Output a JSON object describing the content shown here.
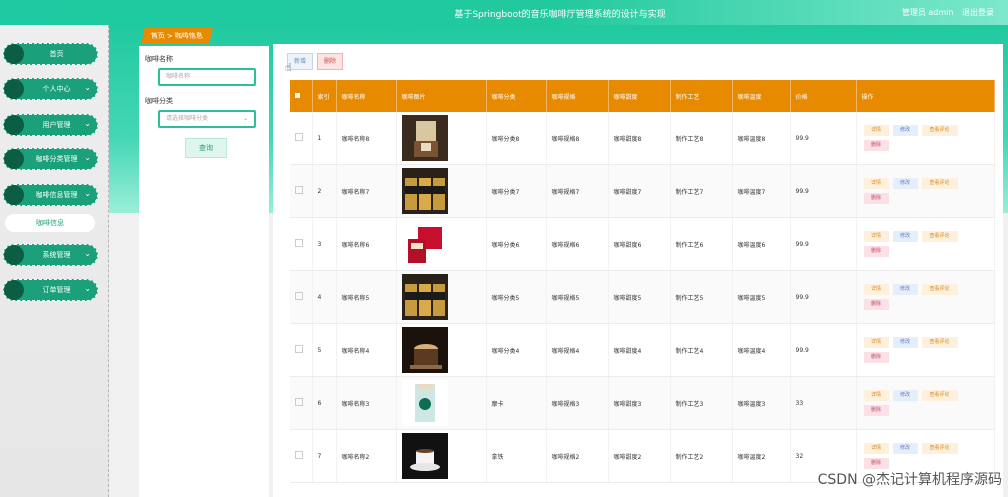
{
  "header": {
    "title": "基于Springboot的音乐咖啡厅管理系统的设计与实现",
    "user": "管理员 admin",
    "logout": "退出登录"
  },
  "sidebar": {
    "items": [
      {
        "label": "首页",
        "expandable": false
      },
      {
        "label": "个人中心",
        "expandable": true
      },
      {
        "label": "用户管理",
        "expandable": true
      },
      {
        "label": "咖啡分类管理",
        "expandable": true
      },
      {
        "label": "咖啡信息管理",
        "expandable": true
      },
      {
        "label": "系统管理",
        "expandable": true
      },
      {
        "label": "订单管理",
        "expandable": true
      }
    ],
    "sub_item": "咖啡信息"
  },
  "tabs": {
    "home": "首页",
    "sep": ">",
    "current": "咖啡信息"
  },
  "search": {
    "name_label": "咖啡名称",
    "name_placeholder": "咖啡名称",
    "category_label": "咖啡分类",
    "category_placeholder": "请选择咖啡分类",
    "query_button": "查询"
  },
  "toolbar": {
    "add_label": "新增",
    "delete_label": "删除"
  },
  "table": {
    "headers": [
      "索引",
      "咖啡名称",
      "咖啡图片",
      "咖啡分类",
      "咖啡规格",
      "咖啡甜度",
      "制作工艺",
      "咖啡温度",
      "价格",
      "操作"
    ],
    "rows": [
      {
        "index": "1",
        "name": "咖啡名称8",
        "category": "咖啡分类8",
        "spec": "咖啡规格8",
        "sweet": "咖啡甜度8",
        "craft": "制作工艺8",
        "temp": "咖啡温度8",
        "price": "99.9",
        "img": "pour"
      },
      {
        "index": "2",
        "name": "咖啡名称7",
        "category": "咖啡分类7",
        "spec": "咖啡规格7",
        "sweet": "咖啡甜度7",
        "craft": "制作工艺7",
        "temp": "咖啡温度7",
        "price": "99.9",
        "img": "cans"
      },
      {
        "index": "3",
        "name": "咖啡名称6",
        "category": "咖啡分类6",
        "spec": "咖啡规格6",
        "sweet": "咖啡甜度6",
        "craft": "制作工艺6",
        "temp": "咖啡温度6",
        "price": "99.9",
        "img": "box"
      },
      {
        "index": "4",
        "name": "咖啡名称5",
        "category": "咖啡分类5",
        "spec": "咖啡规格5",
        "sweet": "咖啡甜度5",
        "craft": "制作工艺5",
        "temp": "咖啡温度5",
        "price": "99.9",
        "img": "cans"
      },
      {
        "index": "5",
        "name": "咖啡名称4",
        "category": "咖啡分类4",
        "spec": "咖啡规格4",
        "sweet": "咖啡甜度4",
        "craft": "制作工艺4",
        "temp": "咖啡温度4",
        "price": "99.9",
        "img": "cup"
      },
      {
        "index": "6",
        "name": "咖啡名称3",
        "category": "摩卡",
        "spec": "咖啡规格3",
        "sweet": "咖啡甜度3",
        "craft": "制作工艺3",
        "temp": "咖啡温度3",
        "price": "33",
        "img": "starbucks"
      },
      {
        "index": "7",
        "name": "咖啡名称2",
        "category": "拿铁",
        "spec": "咖啡规格2",
        "sweet": "咖啡甜度2",
        "craft": "制作工艺2",
        "temp": "咖啡温度2",
        "price": "32",
        "img": "saucer"
      }
    ],
    "ops": {
      "detail": "详情",
      "edit": "修改",
      "comment": "查看评论",
      "del": "删除"
    }
  },
  "watermark": "CSDN @杰记计算机程序源码",
  "colors": {
    "accent": "#1dcaa1",
    "header_orange": "#e88a00",
    "sidebar_item": "#1aa07a"
  }
}
